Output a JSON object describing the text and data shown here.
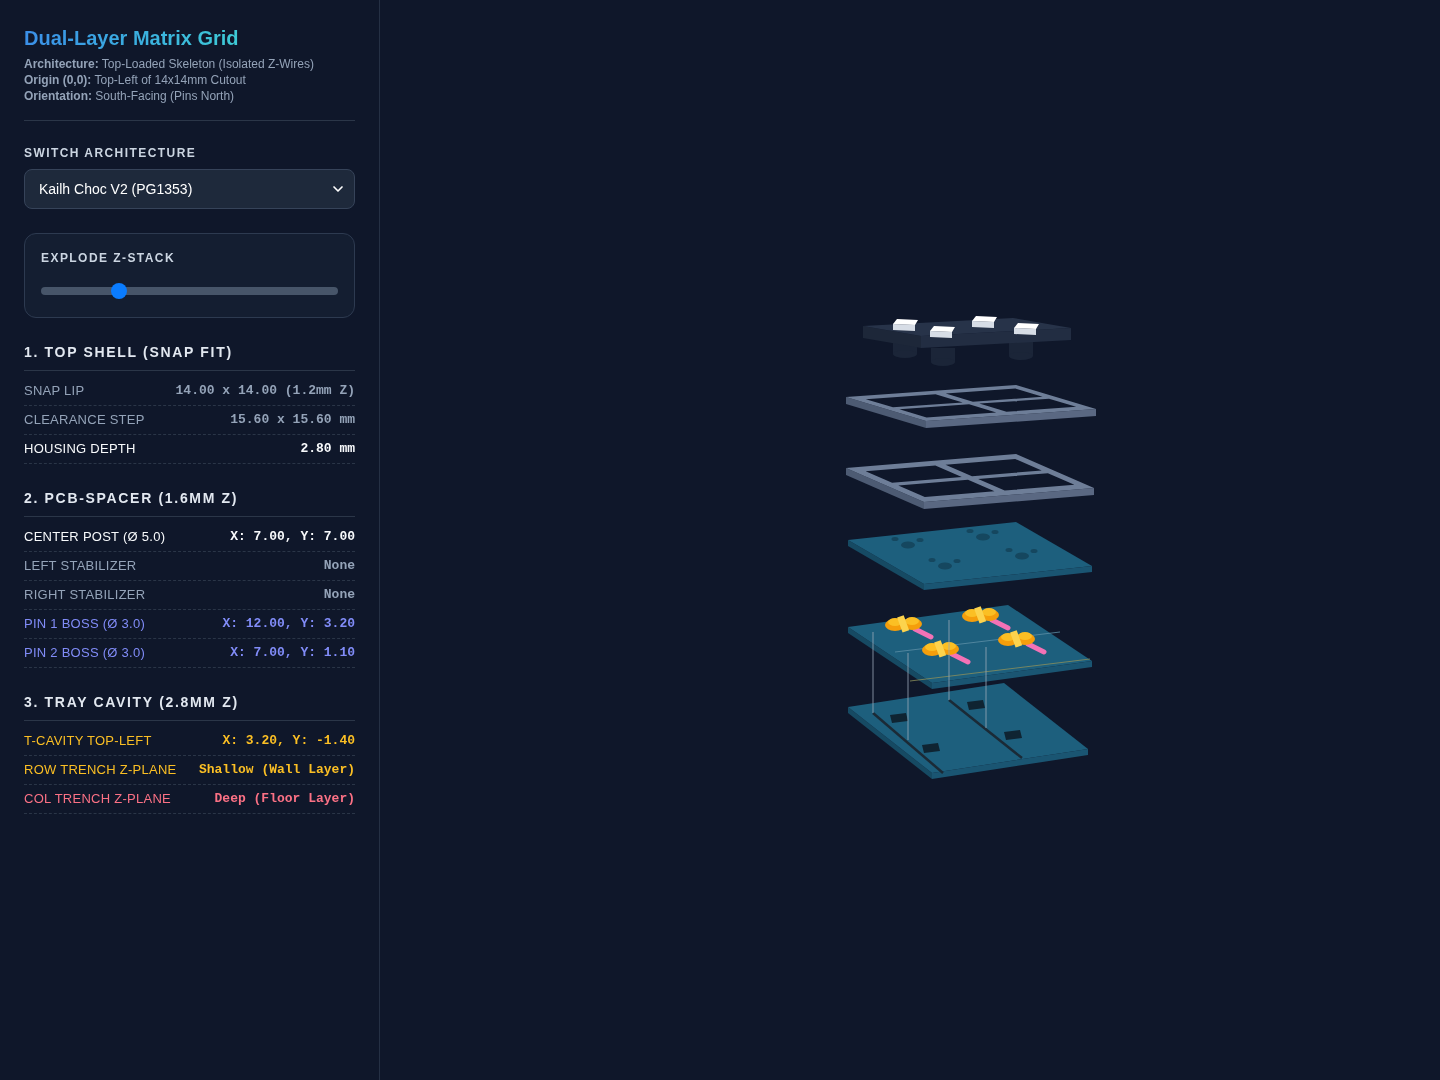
{
  "header": {
    "title": "Dual-Layer Matrix Grid",
    "info": [
      "**Architecture:** Top-Loaded Skeleton (Isolated Z-Wires)",
      "**Origin (0,0):** Top-Left of 14x14mm Cutout",
      "**Orientation:** South-Facing (Pins North)"
    ]
  },
  "switch_architecture": {
    "label": "SWITCH ARCHITECTURE",
    "value": "Kailh Choc V2 (PG1353)"
  },
  "explode": {
    "label": "EXPLODE Z-STACK",
    "level": 0.25
  },
  "sections": [
    {
      "title": "1. TOP SHELL (SNAP FIT)",
      "rows": [
        {
          "label": "SNAP LIP",
          "value": "14.00 x 14.00 (1.2mm Z)",
          "color": "#94a3b8"
        },
        {
          "label": "CLEARANCE STEP",
          "value": "15.60 x 15.60 mm",
          "color": "#94a3b8"
        },
        {
          "label": "HOUSING DEPTH",
          "value": "2.80 mm",
          "color": "#f8fafc"
        }
      ]
    },
    {
      "title": "2. PCB-SPACER (1.6MM Z)",
      "rows": [
        {
          "label": "CENTER POST (Ø 5.0)",
          "value": "X: 7.00, Y: 7.00",
          "color": "#f8fafc"
        },
        {
          "label": "LEFT STABILIZER",
          "value": "None",
          "color": "#94a3b8"
        },
        {
          "label": "RIGHT STABILIZER",
          "value": "None",
          "color": "#94a3b8"
        },
        {
          "label": "PIN 1 BOSS (Ø 3.0)",
          "value": "X: 12.00, Y: 3.20",
          "color": "#818cf8"
        },
        {
          "label": "PIN 2 BOSS (Ø 3.0)",
          "value": "X: 7.00, Y: 1.10",
          "color": "#818cf8"
        }
      ]
    },
    {
      "title": "3. TRAY CAVITY (2.8MM Z)",
      "rows": [
        {
          "label": "T-CAVITY TOP-LEFT",
          "value": "X: 3.20, Y: -1.40",
          "color": "#fbbf24"
        },
        {
          "label": "ROW TRENCH Z-PLANE",
          "value": "Shallow (Wall Layer)",
          "color": "#fbbf24"
        },
        {
          "label": "COL TRENCH Z-PLANE",
          "value": "Deep (Floor Layer)",
          "color": "#fb7185"
        }
      ]
    }
  ]
}
